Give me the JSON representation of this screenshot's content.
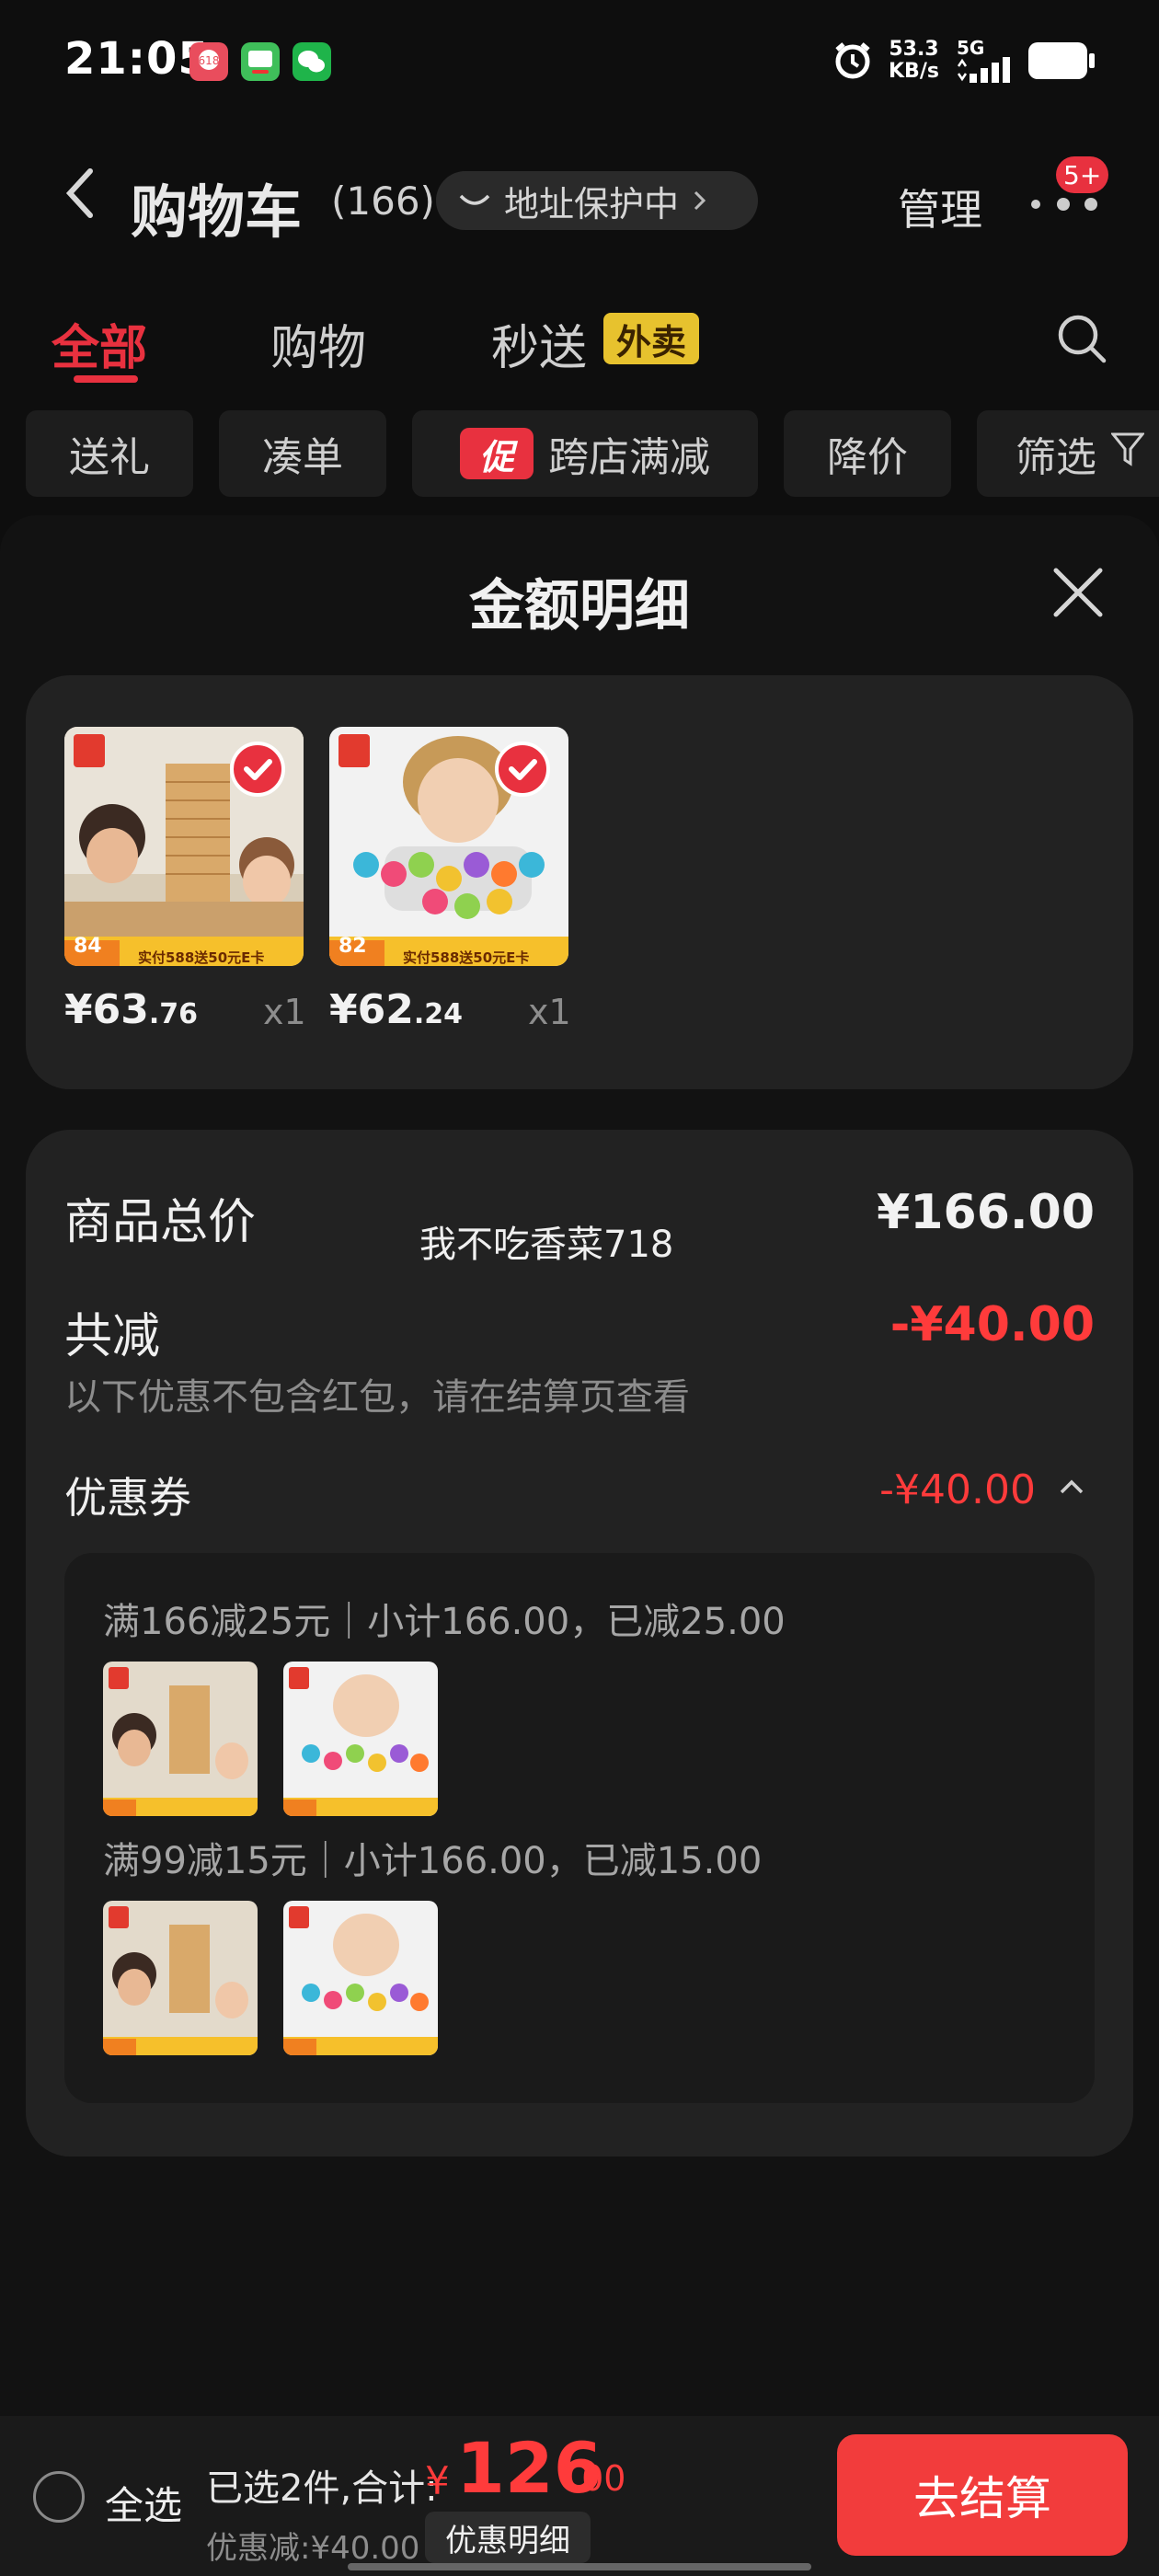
{
  "status_bar": {
    "time": "21:05",
    "net_speed_value": "53.3",
    "net_speed_unit": "KB/s",
    "network": "5G",
    "app_icons": [
      "app-618-icon",
      "coupon-app-icon",
      "wechat-icon"
    ]
  },
  "header": {
    "title": "购物车",
    "count": "(166)",
    "address_pill": "地址保护中",
    "manage": "管理",
    "badge": "5+"
  },
  "tabs": [
    {
      "label": "全部",
      "active": true
    },
    {
      "label": "购物",
      "active": false
    },
    {
      "label": "秒送",
      "active": false,
      "tag": "外卖"
    }
  ],
  "filters": [
    {
      "label": "送礼"
    },
    {
      "label": "凑单"
    },
    {
      "label": "跨店满减",
      "promo": "促"
    },
    {
      "label": "降价"
    },
    {
      "label": "筛选"
    }
  ],
  "sheet": {
    "title": "金额明细",
    "items": [
      {
        "price_int": "¥63",
        "price_dec": ".76",
        "qty": "x1",
        "product": "wooden-tower-toy",
        "tag_num": "84",
        "banner": "实付588送50元E卡"
      },
      {
        "price_int": "¥62",
        "price_dec": ".24",
        "qty": "x1",
        "product": "bead-lacing-toy",
        "tag_num": "82",
        "banner": "实付588送50元E卡"
      }
    ],
    "summary": {
      "total_label": "商品总价",
      "total_value": "¥166.00",
      "watermark": "我不吃香菜718",
      "reduce_label": "共减",
      "reduce_value": "-¥40.00",
      "reduce_note": "以下优惠不包含红包，请在结算页查看",
      "coupon_label": "优惠券",
      "coupon_value": "-¥40.00"
    },
    "coupon_rules": [
      {
        "text": "满166减25元｜小计166.00，已减25.00"
      },
      {
        "text": "满99减15元｜小计166.00，已减15.00"
      }
    ]
  },
  "bottom": {
    "select_all": "全选",
    "selected": "已选2件,合计:",
    "currency": "¥",
    "total_int": "126",
    "total_dec": ".00",
    "discount": "优惠减:¥40.00",
    "detail_button": "优惠明细",
    "checkout": "去结算"
  },
  "colors": {
    "accent": "#e8313f",
    "background": "#0e0e0e",
    "card": "#222222",
    "tag_yellow": "#e7c22e"
  }
}
